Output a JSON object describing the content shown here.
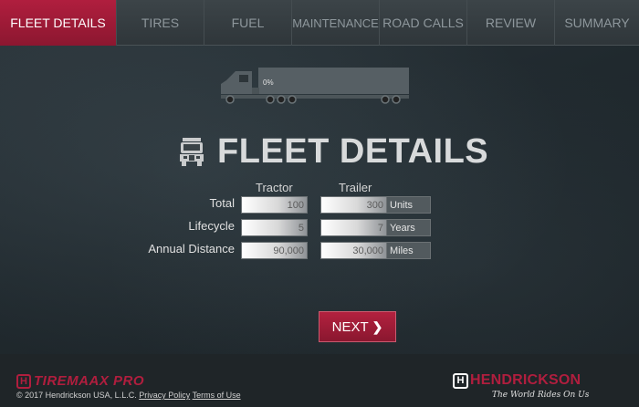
{
  "nav": {
    "tabs": [
      {
        "label": "FLEET DETAILS",
        "active": true
      },
      {
        "label": "TIRES",
        "active": false
      },
      {
        "label": "FUEL",
        "active": false
      },
      {
        "label": "MAINTENANCE",
        "active": false
      },
      {
        "label": "ROAD CALLS",
        "active": false
      },
      {
        "label": "REVIEW",
        "active": false
      },
      {
        "label": "SUMMARY",
        "active": false
      }
    ]
  },
  "progress": {
    "label": "0%",
    "value": 0
  },
  "page": {
    "title": "FLEET DETAILS"
  },
  "table": {
    "columns": {
      "tractor": "Tractor",
      "trailer": "Trailer"
    },
    "rows": [
      {
        "label": "Total",
        "tractor": "100",
        "trailer": "300",
        "unit": "Units"
      },
      {
        "label": "Lifecycle",
        "tractor": "5",
        "trailer": "7",
        "unit": "Years"
      },
      {
        "label": "Annual Distance",
        "tractor": "90,000",
        "trailer": "30,000",
        "unit": "Miles"
      }
    ]
  },
  "next_label": "NEXT",
  "footer": {
    "brand_left": "TIREMAAX PRO",
    "brand_left_mark": "H",
    "copyright": "© 2017 Hendrickson USA, L.L.C.",
    "privacy": "Privacy Policy",
    "terms": "Terms of Use",
    "brand_right": "HENDRICKSON",
    "brand_right_mark": "H",
    "tagline": "The World Rides On Us"
  },
  "colors": {
    "accent": "#b01e3e",
    "nav_bg": "#353c40",
    "unit_bg": "#525a5e"
  }
}
